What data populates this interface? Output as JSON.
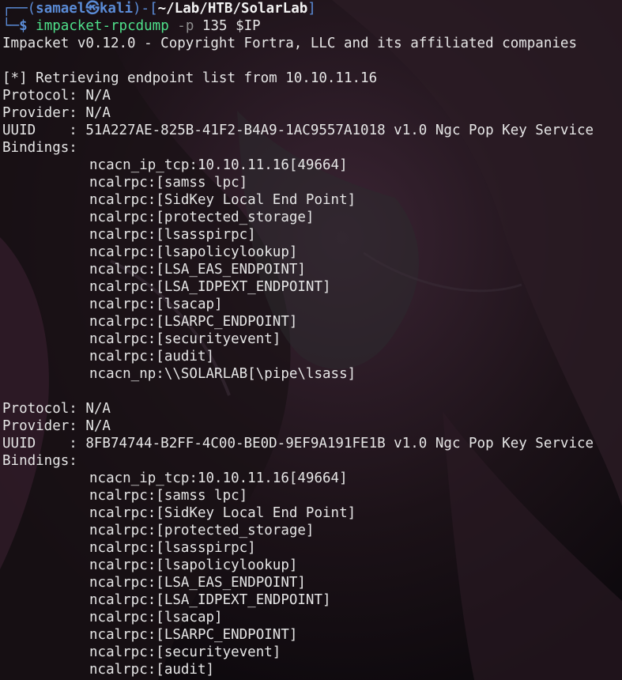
{
  "colors": {
    "prompt_box": "#5a8bd6",
    "command": "#4ee08a",
    "flag": "#8e8e8e",
    "text": "#e6e6e6",
    "background": "#120d12"
  },
  "prompt": {
    "box_top_left": "┌──(",
    "user_host": "samael㉿kali",
    "box_middle": ")-[",
    "cwd": "~/Lab/HTB/SolarLab",
    "box_close": "]",
    "box_bottom": "└─",
    "dollar": "$",
    "command": "impacket-rpcdump",
    "flag": "-p",
    "args": "135 $IP"
  },
  "output": {
    "banner": "Impacket v0.12.0 - Copyright Fortra, LLC and its affiliated companies",
    "retrieving": "[*] Retrieving endpoint list from 10.10.11.16",
    "endpoints": [
      {
        "protocol": "Protocol: N/A",
        "provider": "Provider: N/A",
        "uuid": "UUID    : 51A227AE-825B-41F2-B4A9-1AC9557A1018 v1.0 Ngc Pop Key Service",
        "bindings_label": "Bindings:",
        "bindings": [
          "ncacn_ip_tcp:10.10.11.16[49664]",
          "ncalrpc:[samss lpc]",
          "ncalrpc:[SidKey Local End Point]",
          "ncalrpc:[protected_storage]",
          "ncalrpc:[lsasspirpc]",
          "ncalrpc:[lsapolicylookup]",
          "ncalrpc:[LSA_EAS_ENDPOINT]",
          "ncalrpc:[LSA_IDPEXT_ENDPOINT]",
          "ncalrpc:[lsacap]",
          "ncalrpc:[LSARPC_ENDPOINT]",
          "ncalrpc:[securityevent]",
          "ncalrpc:[audit]",
          "ncacn_np:\\\\SOLARLAB[\\pipe\\lsass]"
        ]
      },
      {
        "protocol": "Protocol: N/A",
        "provider": "Provider: N/A",
        "uuid": "UUID    : 8FB74744-B2FF-4C00-BE0D-9EF9A191FE1B v1.0 Ngc Pop Key Service",
        "bindings_label": "Bindings:",
        "bindings": [
          "ncacn_ip_tcp:10.10.11.16[49664]",
          "ncalrpc:[samss lpc]",
          "ncalrpc:[SidKey Local End Point]",
          "ncalrpc:[protected_storage]",
          "ncalrpc:[lsasspirpc]",
          "ncalrpc:[lsapolicylookup]",
          "ncalrpc:[LSA_EAS_ENDPOINT]",
          "ncalrpc:[LSA_IDPEXT_ENDPOINT]",
          "ncalrpc:[lsacap]",
          "ncalrpc:[LSARPC_ENDPOINT]",
          "ncalrpc:[securityevent]",
          "ncalrpc:[audit]"
        ]
      }
    ]
  }
}
